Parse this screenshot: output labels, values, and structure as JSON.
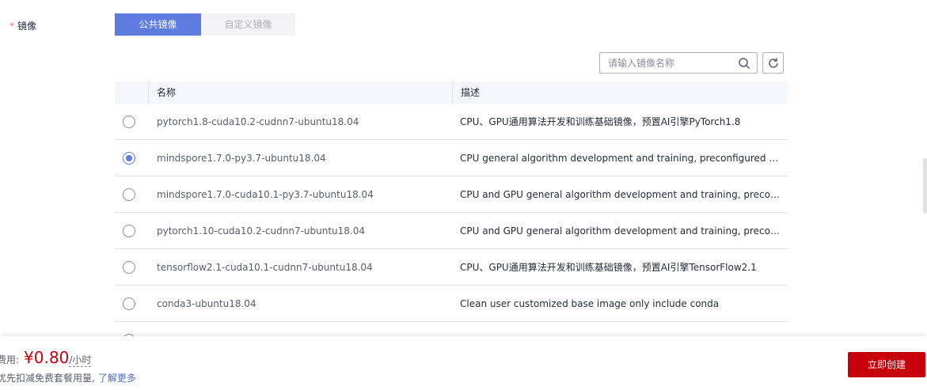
{
  "field": {
    "required_mark": "*",
    "label": "镜像"
  },
  "tabs": [
    {
      "label": "公共镜像",
      "active": true
    },
    {
      "label": "自定义镜像",
      "active": false
    }
  ],
  "search": {
    "placeholder": "请输入镜像名称",
    "value": ""
  },
  "table": {
    "headers": [
      "名称",
      "描述"
    ],
    "rows": [
      {
        "name": "pytorch1.8-cuda10.2-cudnn7-ubuntu18.04",
        "description": "CPU、GPU通用算法开发和训练基础镜像，预置AI引擎PyTorch1.8",
        "selected": false
      },
      {
        "name": "mindspore1.7.0-py3.7-ubuntu18.04",
        "description": "CPU general algorithm development and training, preconfigured with AI...",
        "selected": true
      },
      {
        "name": "mindspore1.7.0-cuda10.1-py3.7-ubuntu18.04",
        "description": "CPU and GPU general algorithm development and training, preconfigur...",
        "selected": false
      },
      {
        "name": "pytorch1.10-cuda10.2-cudnn7-ubuntu18.04",
        "description": "CPU and GPU general algorithm development and training, preconfigur...",
        "selected": false
      },
      {
        "name": "tensorflow2.1-cuda10.1-cudnn7-ubuntu18.04",
        "description": "CPU、GPU通用算法开发和训练基础镜像，预置AI引擎TensorFlow2.1",
        "selected": false
      },
      {
        "name": "conda3-ubuntu18.04",
        "description": "Clean user customized base image only include conda",
        "selected": false
      }
    ]
  },
  "footer": {
    "fee_label": "费用:",
    "price": "¥0.80",
    "unit": "/小时",
    "note": "优先扣减免费套餐用量,",
    "learn_more": "了解更多",
    "create_label": "立即创建"
  },
  "colors": {
    "accent": "#5e7ce0",
    "brand_red": "#c7000b",
    "link": "#526ecc"
  }
}
